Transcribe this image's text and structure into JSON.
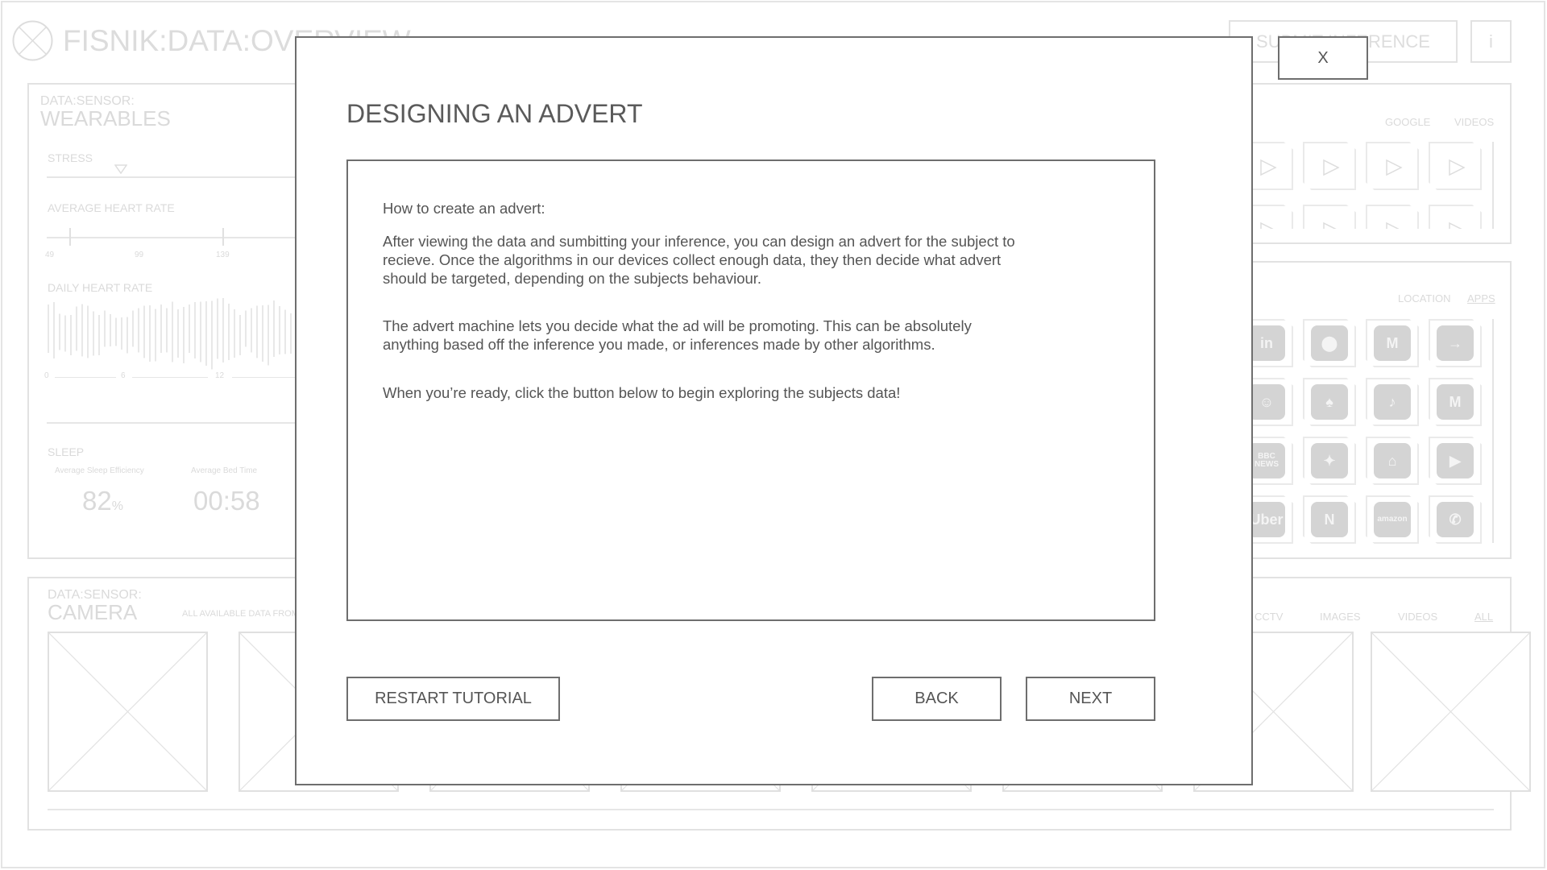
{
  "header": {
    "title": "FISNIK:DATA:OVERVIEW",
    "submit_label": "SUBMIT INFERENCE",
    "info_label": "i"
  },
  "wearables": {
    "kicker": "DATA:SENSOR:",
    "title": "WEARABLES",
    "stress_label": "STRESS",
    "avg_hr_label": "AVERAGE HEART RATE",
    "avg_hr_ticks": [
      "49",
      "99",
      "139"
    ],
    "daily_hr_label": "DAILY HEART RATE",
    "daily_hr_ticks": [
      "0",
      "6",
      "12"
    ],
    "sleep_label": "SLEEP",
    "sleep_eff_label": "Average Sleep Efficiency",
    "sleep_eff_value": "82",
    "sleep_eff_unit": "%",
    "bed_time_label": "Average Bed Time",
    "bed_time_value": "00:58"
  },
  "search_panel": {
    "tabs": [
      "GOOGLE",
      "VIDEOS"
    ]
  },
  "apps_panel": {
    "tabs": [
      "LOCATION",
      "APPS"
    ],
    "active_tab": "APPS",
    "apps": [
      {
        "icon": "linkedin-icon",
        "glyph": "in"
      },
      {
        "icon": "google-maps-icon",
        "glyph": "⬤"
      },
      {
        "icon": "gmail-m-icon",
        "glyph": "M"
      },
      {
        "icon": "transit-icon",
        "glyph": "→"
      },
      {
        "icon": "snapchat-icon",
        "glyph": "☺"
      },
      {
        "icon": "barclays-eagle-icon",
        "glyph": "♠"
      },
      {
        "icon": "tiktok-icon",
        "glyph": "♪"
      },
      {
        "icon": "gmail-icon",
        "glyph": "M"
      },
      {
        "icon": "bbc-news-icon",
        "glyph": "BBC NEWS"
      },
      {
        "icon": "google-photos-icon",
        "glyph": "✦"
      },
      {
        "icon": "google-home-icon",
        "glyph": "⌂"
      },
      {
        "icon": "youtube-icon",
        "glyph": "▶"
      },
      {
        "icon": "uber-icon",
        "glyph": "Uber"
      },
      {
        "icon": "netflix-icon",
        "glyph": "N"
      },
      {
        "icon": "amazon-icon",
        "glyph": "amazon"
      },
      {
        "icon": "whatsapp-icon",
        "glyph": "✆"
      }
    ]
  },
  "camera": {
    "kicker": "DATA:SENSOR:",
    "title": "CAMERA",
    "subtitle": "ALL AVAILABLE DATA FROM",
    "tabs": [
      "CCTV",
      "IMAGES",
      "VIDEOS",
      "ALL"
    ],
    "active_tab": "ALL"
  },
  "modal": {
    "close_label": "X",
    "title": "DESIGNING AN ADVERT",
    "lines": [
      "How to create an advert:",
      "After viewing the data and sumbitting your inference, you can design an advert for the subject to",
      "recieve. Once the algorithms in our devices collect enough data, they then decide what advert",
      "should be targeted, depending on the subjects behaviour.",
      "The advert machine lets you decide what the ad will be promoting. This can be absolutely",
      "anything based off the inference you made, or inferences made by other algorithms.",
      "When you’re ready, click the button below to begin exploring the subjects data!"
    ],
    "restart_label": "RESTART TUTORIAL",
    "back_label": "BACK",
    "next_label": "NEXT"
  }
}
